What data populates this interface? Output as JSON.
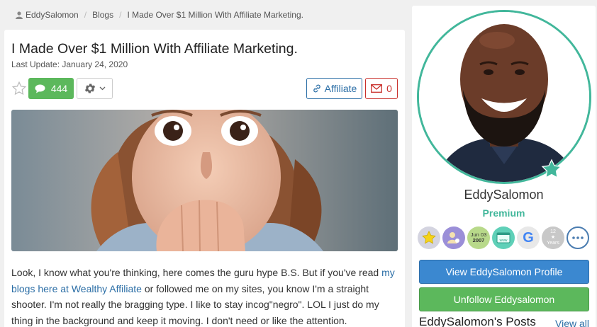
{
  "breadcrumb": {
    "user": "EddySalomon",
    "section": "Blogs",
    "current": "I Made Over $1 Million With Affiliate Marketing."
  },
  "post": {
    "title": "I Made Over $1 Million With Affiliate Marketing.",
    "last_update": "Last Update: January 24, 2020",
    "comment_count": "444",
    "affiliate_label": "Affiliate",
    "mail_count": "0",
    "body_lead": "Look, I know what you're thinking, here comes the guru hype B.S. But if you've read ",
    "body_link": "my blogs here at Wealthy Affiliate",
    "body_rest": " or followed me on my sites, you know I'm a straight shooter. I'm not really the bragging type. I like to stay incog\"negro\". LOL I just do my thing in the background and keep it moving. I don't need or like the attention."
  },
  "sidebar": {
    "username": "EddySalomon",
    "membership": "Premium",
    "badges": [
      {
        "icon": "star-badge-icon",
        "color": "#d4d4e0"
      },
      {
        "icon": "user-gear-badge-icon",
        "color": "#9b8fd8"
      },
      {
        "icon": "date-badge-icon",
        "color": "#b8d98a",
        "line1": "Jun 03",
        "line2": "2007"
      },
      {
        "icon": "website-badge-icon",
        "color": "#5fd0b8",
        "label": "www"
      },
      {
        "icon": "google-badge-icon",
        "color": "#e8e8e8"
      },
      {
        "icon": "years-badge-icon",
        "color": "#c8c8c8",
        "line1": "12",
        "line2": "Years"
      },
      {
        "icon": "more-icon",
        "color": "#ffffff"
      }
    ],
    "view_profile_label": "View EddySalomon Profile",
    "unfollow_label": "Unfollow Eddysalomon",
    "posts_heading": "EddySalomon's Posts",
    "view_all_label": "View all"
  },
  "colors": {
    "accent_green": "#5cb85c",
    "accent_blue": "#3b88d0",
    "premium_teal": "#42b79b",
    "link_blue": "#2b6ea6",
    "mail_red": "#c9302c"
  }
}
